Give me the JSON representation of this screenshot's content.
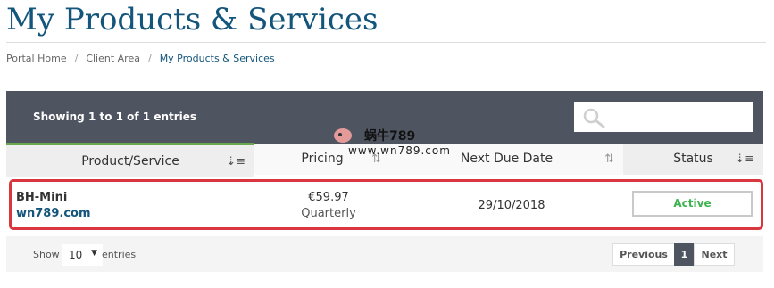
{
  "page": {
    "title": "My Products & Services"
  },
  "breadcrumb": {
    "items": [
      "Portal Home",
      "Client Area",
      "My Products & Services"
    ],
    "separator": "/"
  },
  "table_toolbar": {
    "info": "Showing 1 to 1 of 1 entries",
    "search_icon": "search-icon",
    "search_placeholder": ""
  },
  "table": {
    "columns": [
      {
        "label": "Product/Service",
        "sort_icon": "sort-ascending-icon",
        "glyph": "⇣≡"
      },
      {
        "label": "Pricing",
        "sort_icon": "sort-both-icon",
        "glyph": "⇅"
      },
      {
        "label": "Next Due Date",
        "sort_icon": "sort-both-icon",
        "glyph": "⇅"
      },
      {
        "label": "Status",
        "sort_icon": "sort-ascending-icon",
        "glyph": "⇣≡"
      }
    ],
    "rows": [
      {
        "product": "BH-Mini",
        "domain": "wn789.com",
        "price": "€59.97",
        "cycle": "Quarterly",
        "next_due": "29/10/2018",
        "status": "Active"
      }
    ]
  },
  "footer": {
    "show_label": "Show",
    "length_value": "10",
    "length_caret": "▼",
    "entries_label": "entries",
    "pager": {
      "previous": "Previous",
      "current": "1",
      "next": "Next"
    }
  },
  "watermark": {
    "title": "蜗牛789",
    "url": "www.wn789.com"
  },
  "colors": {
    "accent": "#14557b",
    "toolbar": "#4f5461",
    "status_active": "#3fb34f",
    "highlight": "#d9363e",
    "sorted_marker": "#6aa84f"
  }
}
